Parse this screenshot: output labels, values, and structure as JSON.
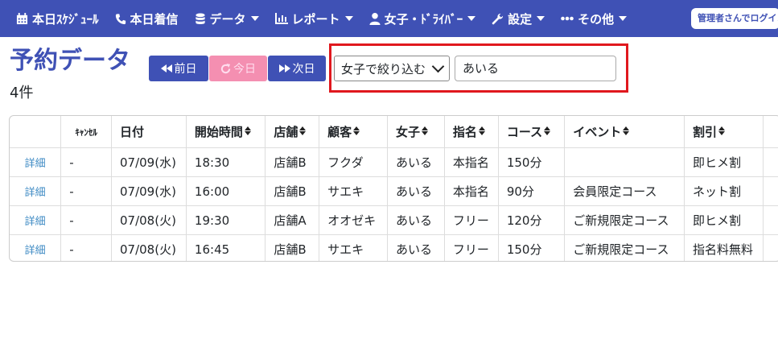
{
  "nav": {
    "schedule": "本日ｽｹｼﾞｭｰﾙ",
    "calls": "本日着信",
    "data": "データ",
    "report": "レポート",
    "girls": "女子・ﾄﾞﾗｲﾊﾞｰ",
    "settings": "設定",
    "other": "その他",
    "admin": "管理者さんでログイン中"
  },
  "page": {
    "title": "予約データ",
    "count": "4件"
  },
  "buttons": {
    "prev": "前日",
    "today": "今日",
    "next": "次日"
  },
  "filter": {
    "select_value": "女子で絞り込む",
    "input_value": "あいる"
  },
  "table": {
    "headers": [
      "",
      "ｷｬﾝｾﾙ",
      "日付",
      "開始時間",
      "店舗",
      "顧客",
      "女子",
      "指名",
      "コース",
      "イベント",
      "割引",
      ""
    ],
    "rows": [
      {
        "detail": "詳細",
        "cancel": "-",
        "date": "07/09(水)",
        "time": "18:30",
        "store": "店舗B",
        "customer": "フクダ",
        "girl": "あいる",
        "nomination": "本指名",
        "course": "150分",
        "event": "",
        "discount": "即ヒメ割"
      },
      {
        "detail": "詳細",
        "cancel": "-",
        "date": "07/09(水)",
        "time": "16:00",
        "store": "店舗B",
        "customer": "サエキ",
        "girl": "あいる",
        "nomination": "本指名",
        "course": "90分",
        "event": "会員限定コース",
        "discount": "ネット割"
      },
      {
        "detail": "詳細",
        "cancel": "-",
        "date": "07/08(火)",
        "time": "19:30",
        "store": "店舗A",
        "customer": "オオゼキ",
        "girl": "あいる",
        "nomination": "フリー",
        "course": "120分",
        "event": "ご新規限定コース",
        "discount": "即ヒメ割"
      },
      {
        "detail": "詳細",
        "cancel": "-",
        "date": "07/08(火)",
        "time": "16:45",
        "store": "店舗B",
        "customer": "サエキ",
        "girl": "あいる",
        "nomination": "フリー",
        "course": "150分",
        "event": "ご新規限定コース",
        "discount": "指名料無料"
      }
    ]
  },
  "colors": {
    "nav_bg": "#3f51b5",
    "today_btn": "#f48fb1",
    "highlight": "#e0181e",
    "link": "#3f8bc4"
  }
}
